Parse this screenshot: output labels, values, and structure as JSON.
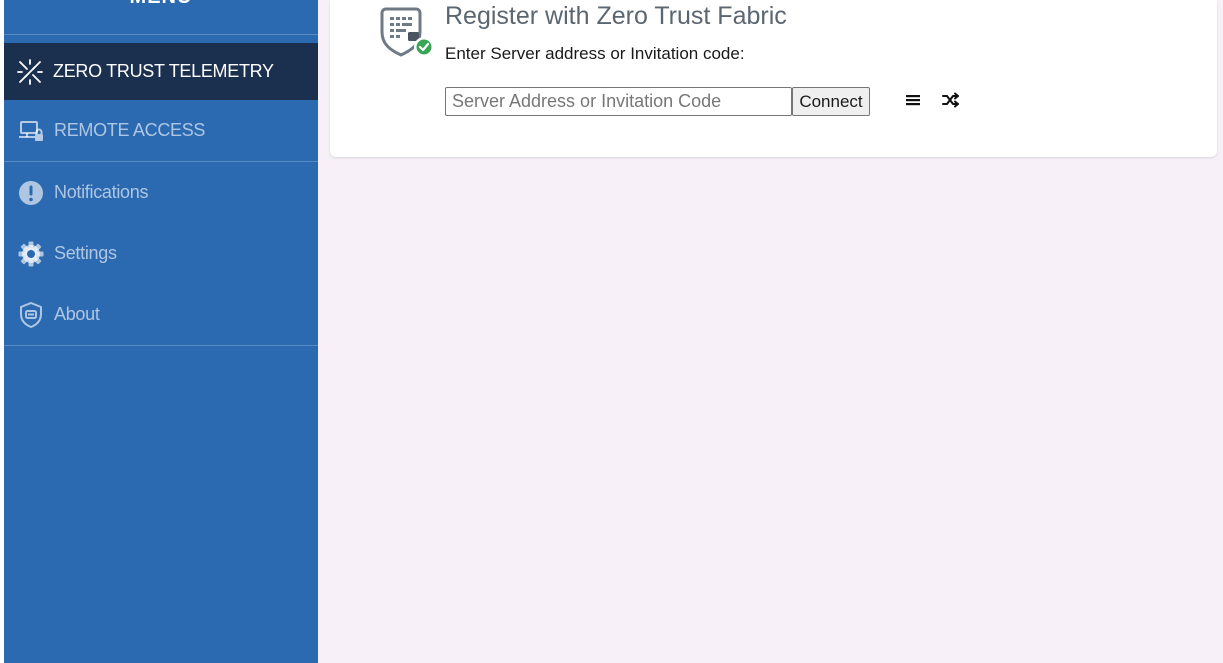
{
  "sidebar": {
    "header_text": "MENU",
    "items": [
      {
        "label": "ZERO TRUST TELEMETRY",
        "icon": "telemetry-icon",
        "active": true
      },
      {
        "label": "REMOTE ACCESS",
        "icon": "remote-access-icon",
        "active": false
      },
      {
        "label": "Notifications",
        "icon": "notification-icon",
        "active": false
      },
      {
        "label": "Settings",
        "icon": "gear-icon",
        "active": false
      },
      {
        "label": "About",
        "icon": "shield-icon",
        "active": false
      }
    ]
  },
  "register": {
    "title": "Register with Zero Trust Fabric",
    "subtitle": "Enter Server address or Invitation code:",
    "input_value": "",
    "input_placeholder": "Server Address or Invitation Code",
    "connect_label": "Connect",
    "tools": [
      "menu-icon",
      "shuffle-icon"
    ]
  },
  "colors": {
    "sidebar_bg": "#2b69b1",
    "sidebar_active_bg": "#1b2f4e",
    "main_bg": "#f7f0f8",
    "status_green": "#3aa655"
  }
}
